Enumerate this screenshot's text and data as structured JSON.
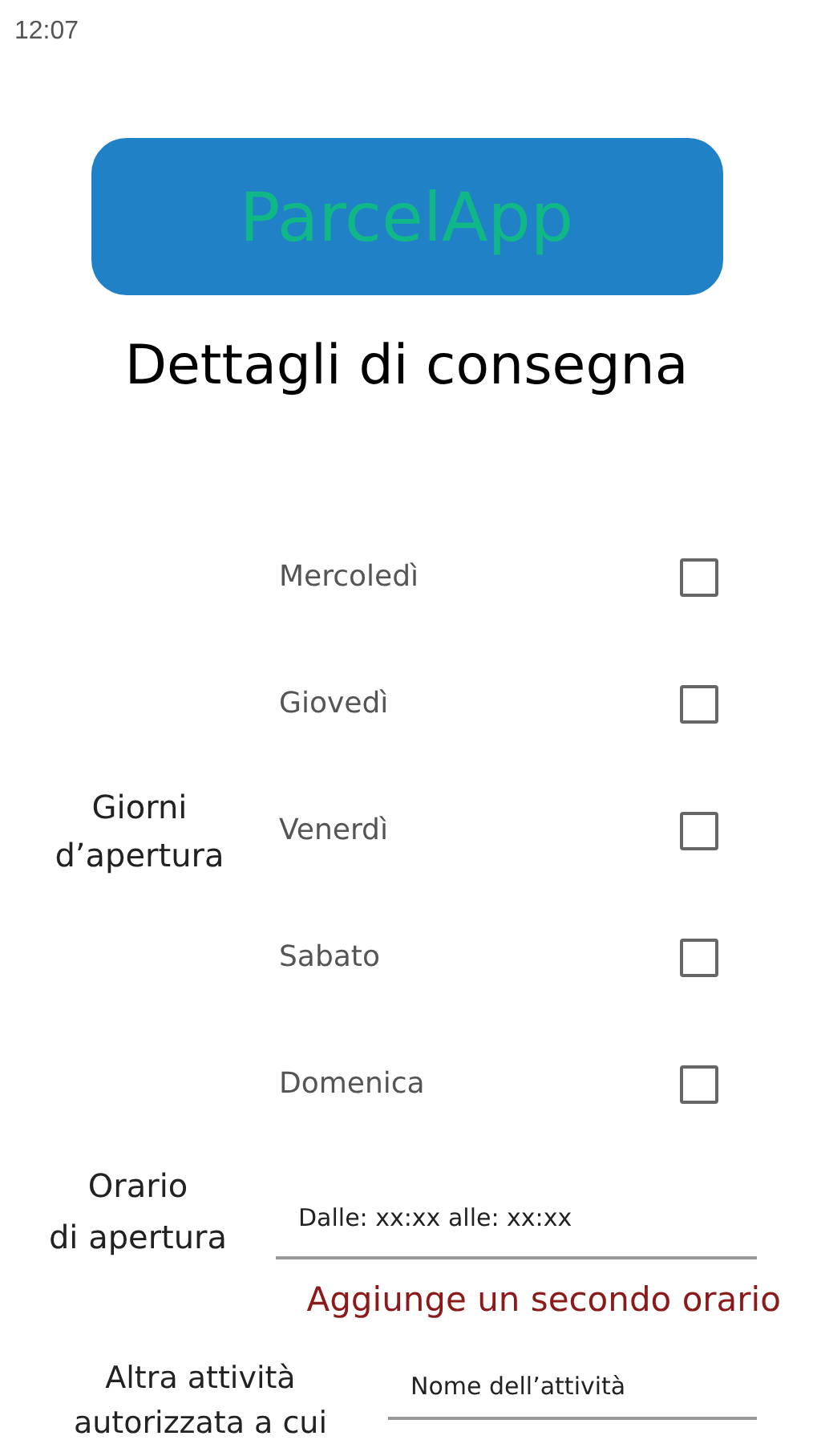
{
  "status_bar": {
    "time": "12:07"
  },
  "logo": {
    "text": "ParcelApp"
  },
  "title": "Dettagli di consegna",
  "opening_days": {
    "label": "Giorni d’apertura",
    "days": [
      {
        "label": "Mercoledì",
        "checked": false
      },
      {
        "label": "Giovedì",
        "checked": false
      },
      {
        "label": "Venerdì",
        "checked": false
      },
      {
        "label": "Sabato",
        "checked": false
      },
      {
        "label": "Domenica",
        "checked": false
      }
    ]
  },
  "opening_hours": {
    "label_lines": [
      "Orario",
      "di apertura"
    ],
    "placeholder": "Dalle: xx:xx alle: xx:xx"
  },
  "add_second_hours_link": "Aggiunge un secondo orario",
  "other_business": {
    "label_lines": [
      "Altra attività",
      "autorizzata a cui"
    ],
    "placeholder": "Nome dell’attività"
  }
}
